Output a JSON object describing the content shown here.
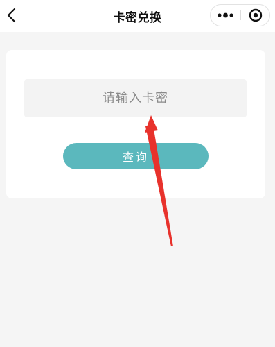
{
  "navbar": {
    "title": "卡密兑换",
    "back_icon": "chevron-left-icon",
    "more_icon": "more-dots-icon",
    "close_icon": "target-circle-icon"
  },
  "form": {
    "input_value": "",
    "input_placeholder": "请输入卡密",
    "query_label": "查询"
  },
  "colors": {
    "page_bg": "#f5f5f5",
    "card_bg": "#ffffff",
    "input_bg": "#f3f3f3",
    "button_bg": "#5bb8bd",
    "annotation_arrow": "#e8322c"
  },
  "annotation": {
    "type": "arrow",
    "points_to": "code-input"
  }
}
